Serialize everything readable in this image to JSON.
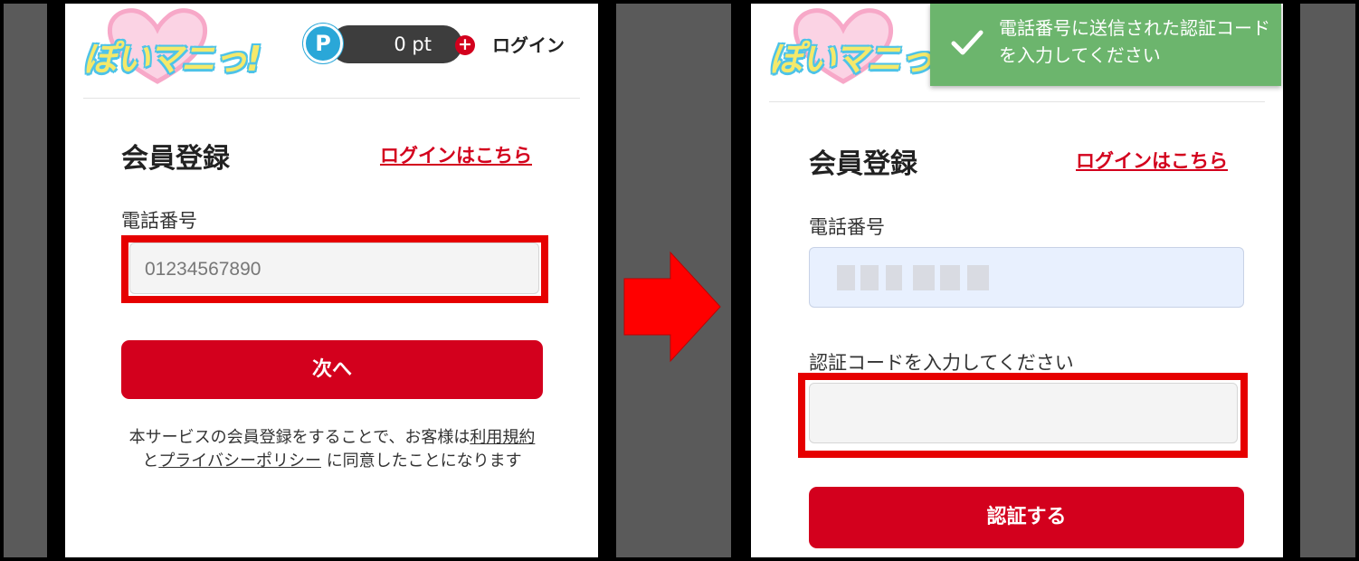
{
  "header": {
    "logo_text": "ぽいマニっ!",
    "points_badge": "P",
    "points_value": "0 pt",
    "add_points": "+",
    "login": "ログイン"
  },
  "left_screen": {
    "title": "会員登録",
    "login_here": "ログインはこちら",
    "phone_label": "電話番号",
    "phone_placeholder": "01234567890",
    "next_button": "次へ",
    "terms": {
      "prefix": "本サービスの会員登録をすることで、お客様は",
      "terms_link": "利用規約",
      "and": "と",
      "privacy_link": "プライバシーポリシー",
      "suffix": "に同意したことになります"
    }
  },
  "right_screen": {
    "toast_message": "電話番号に送信された認証コードを入力してください",
    "title": "会員登録",
    "login_here": "ログインはこちら",
    "phone_label": "電話番号",
    "code_label": "認証コードを入力してください",
    "verify_button": "認証する"
  },
  "colors": {
    "brand_red": "#d3001d",
    "highlight_red": "#e60000",
    "toast_green": "#6cb56d",
    "arrow_red": "#ff0000"
  }
}
